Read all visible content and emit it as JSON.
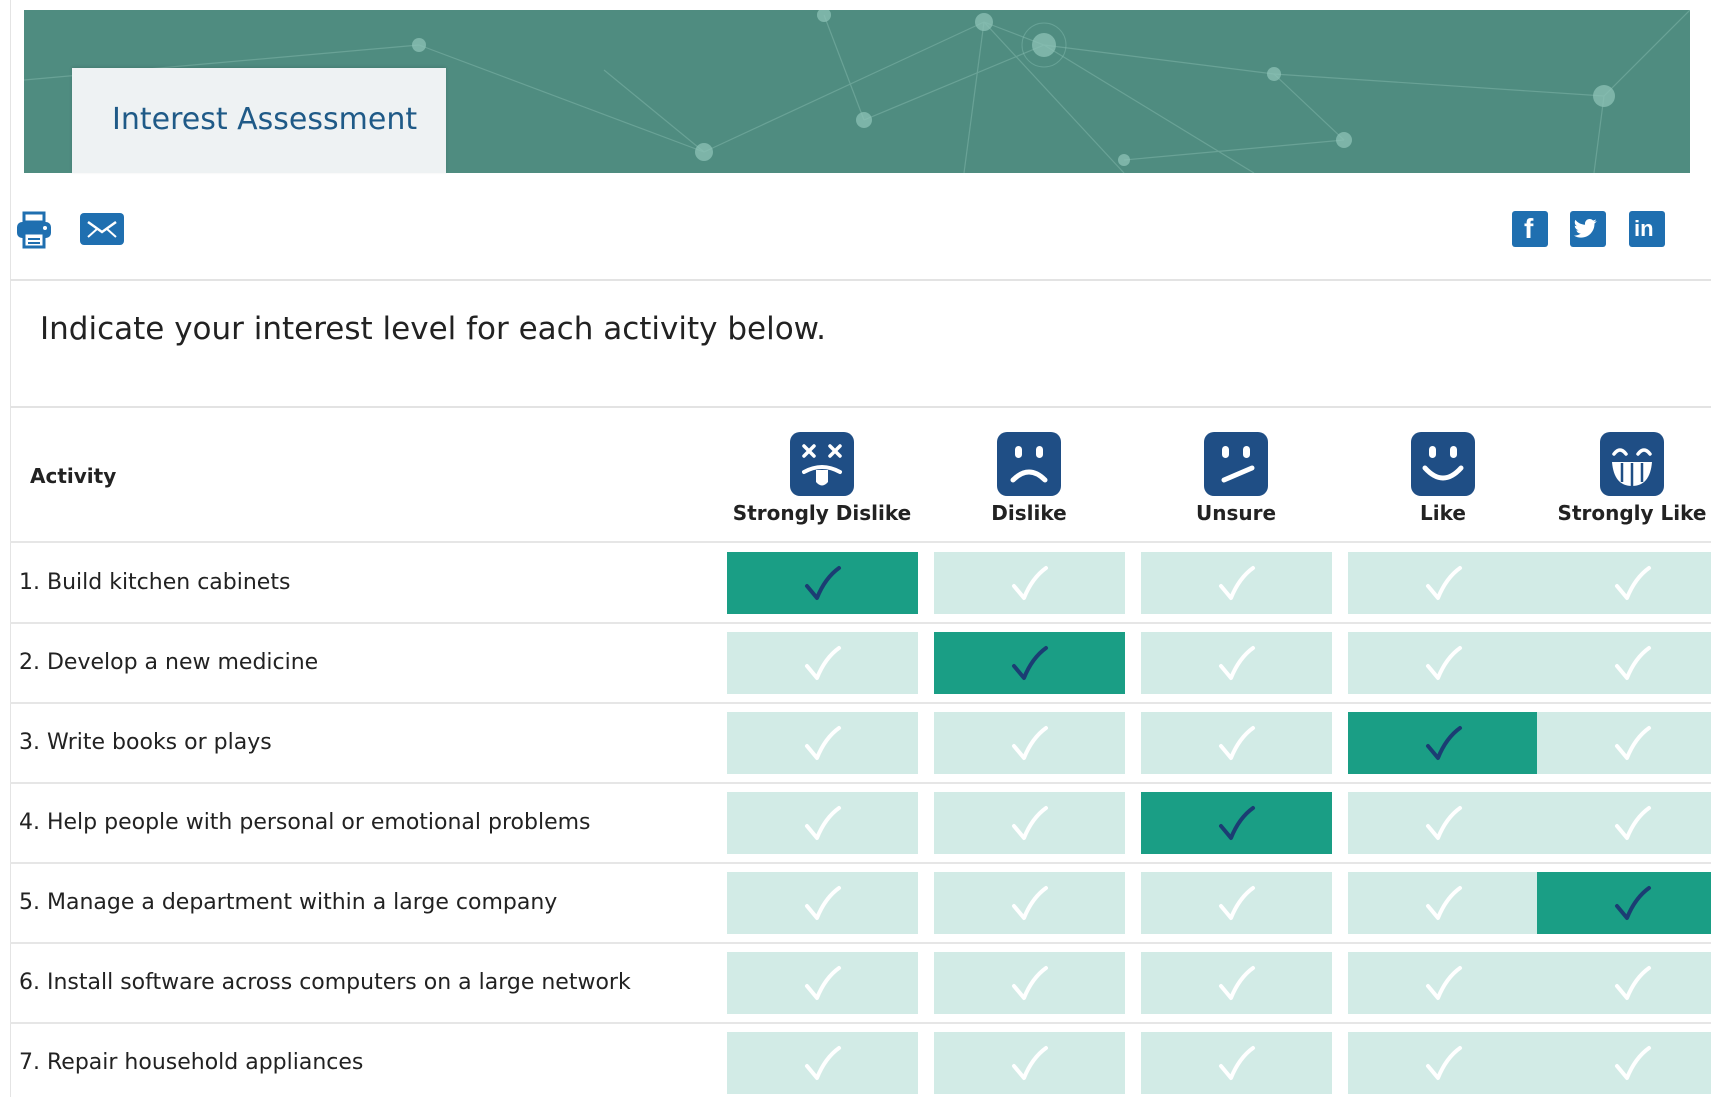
{
  "header": {
    "title": "Interest Assessment"
  },
  "toolbar": {
    "left_icons": [
      "printer-icon",
      "email-icon"
    ],
    "social_icons": [
      "facebook-icon",
      "twitter-icon",
      "linkedin-icon"
    ],
    "social_letters": {
      "facebook": "f",
      "linkedin": "in"
    }
  },
  "instructions": "Indicate your interest level for each activity below.",
  "table": {
    "activity_header": "Activity",
    "columns": [
      {
        "label": "Strongly Dislike",
        "icon": "dead-face-icon"
      },
      {
        "label": "Dislike",
        "icon": "sad-face-icon"
      },
      {
        "label": "Unsure",
        "icon": "unsure-face-icon"
      },
      {
        "label": "Like",
        "icon": "smile-face-icon"
      },
      {
        "label": "Strongly Like",
        "icon": "grin-face-icon"
      }
    ],
    "rows": [
      {
        "label": "1. Build kitchen cabinets",
        "selected": 0
      },
      {
        "label": "2. Develop a new medicine",
        "selected": 1
      },
      {
        "label": "3. Write books or plays",
        "selected": 3
      },
      {
        "label": "4. Help people with personal or emotional problems",
        "selected": 2
      },
      {
        "label": "5. Manage a department within a large company",
        "selected": 4
      },
      {
        "label": "6. Install software across computers on a large network",
        "selected": null
      },
      {
        "label": "7. Repair household appliances",
        "selected": null
      }
    ]
  },
  "colors": {
    "banner": "#4f8c80",
    "title_text": "#1f5a87",
    "icon_blue": "#1f4e85",
    "cell_unselected": "#d2ebe6",
    "cell_selected": "#1a9e85",
    "check_selected": "#1b3d73"
  }
}
